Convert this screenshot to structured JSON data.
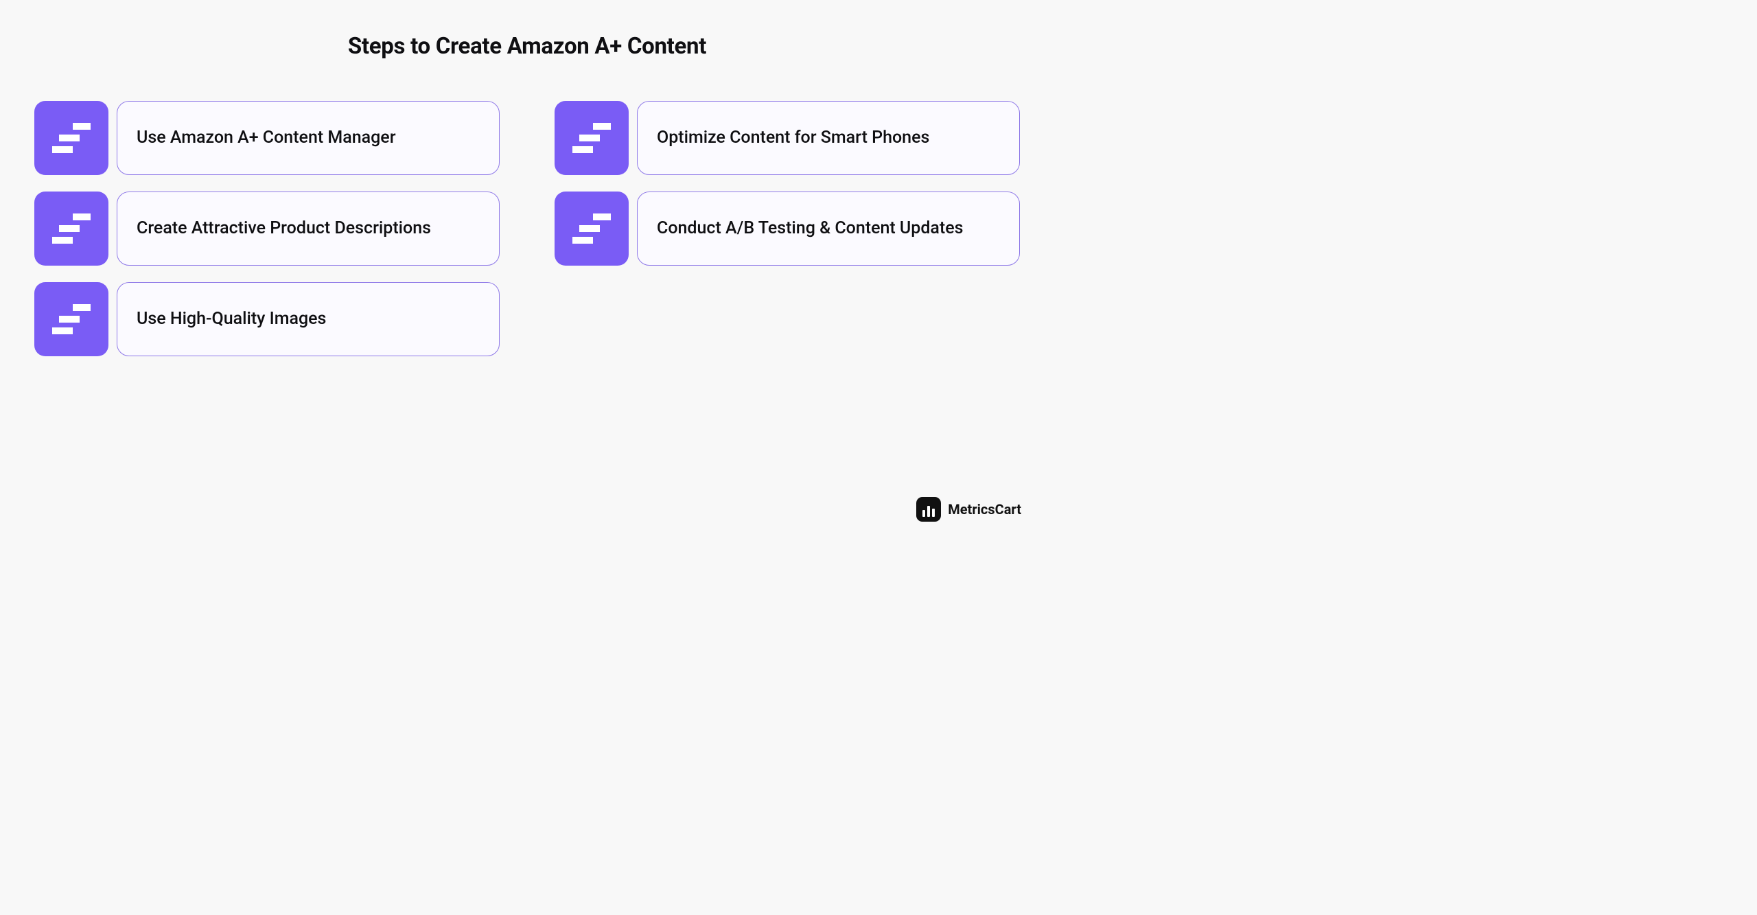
{
  "title": "Steps to Create Amazon A+ Content",
  "columns": {
    "left": [
      {
        "label": "Use Amazon A+ Content Manager"
      },
      {
        "label": "Create Attractive Product Descriptions"
      },
      {
        "label": "Use High-Quality Images"
      }
    ],
    "right": [
      {
        "label": "Optimize Content for Smart Phones"
      },
      {
        "label": "Conduct A/B Testing & Content Updates"
      }
    ]
  },
  "brand": "MetricsCart"
}
